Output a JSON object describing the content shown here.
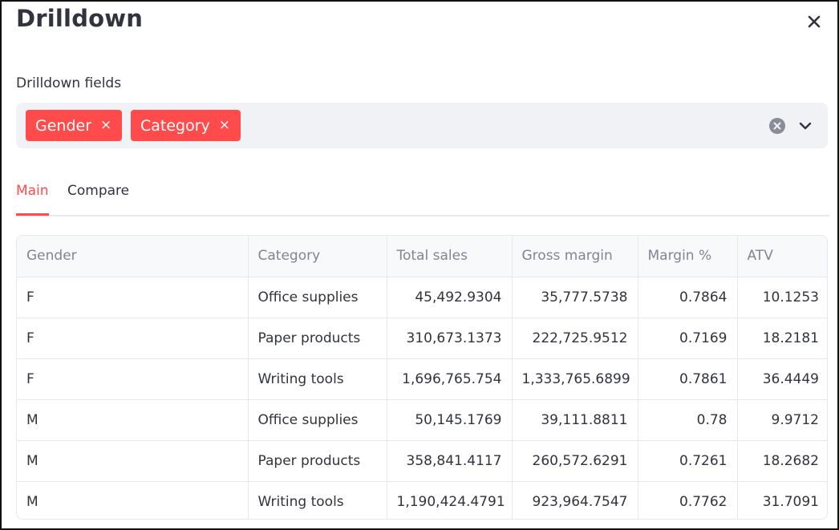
{
  "dialog": {
    "title": "Drilldown",
    "close_icon": "close-icon"
  },
  "drilldown": {
    "label": "Drilldown fields",
    "tags": [
      "Gender",
      "Category"
    ],
    "tag_remove_glyph": "×",
    "clear_icon": "clear-circle-icon",
    "dropdown_icon": "chevron-down-icon"
  },
  "tabs": [
    "Main",
    "Compare"
  ],
  "active_tab": "Main",
  "table": {
    "columns": [
      "Gender",
      "Category",
      "Total sales",
      "Gross margin",
      "Margin %",
      "ATV"
    ],
    "rows": [
      [
        "F",
        "Office supplies",
        "45,492.9304",
        "35,777.5738",
        "0.7864",
        "10.1253"
      ],
      [
        "F",
        "Paper products",
        "310,673.1373",
        "222,725.9512",
        "0.7169",
        "18.2181"
      ],
      [
        "F",
        "Writing tools",
        "1,696,765.754",
        "1,333,765.6899",
        "0.7861",
        "36.4449"
      ],
      [
        "M",
        "Office supplies",
        "50,145.1769",
        "39,111.8811",
        "0.78",
        "9.9712"
      ],
      [
        "M",
        "Paper products",
        "358,841.4117",
        "260,572.6291",
        "0.7261",
        "18.2682"
      ],
      [
        "M",
        "Writing tools",
        "1,190,424.4791",
        "923,964.7547",
        "0.7762",
        "31.7091"
      ]
    ]
  },
  "colors": {
    "accent": "#ff4b4b",
    "input_bg": "#f0f2f6",
    "header_text": "#808495",
    "text": "#31333f",
    "border": "#e6e8ee"
  }
}
